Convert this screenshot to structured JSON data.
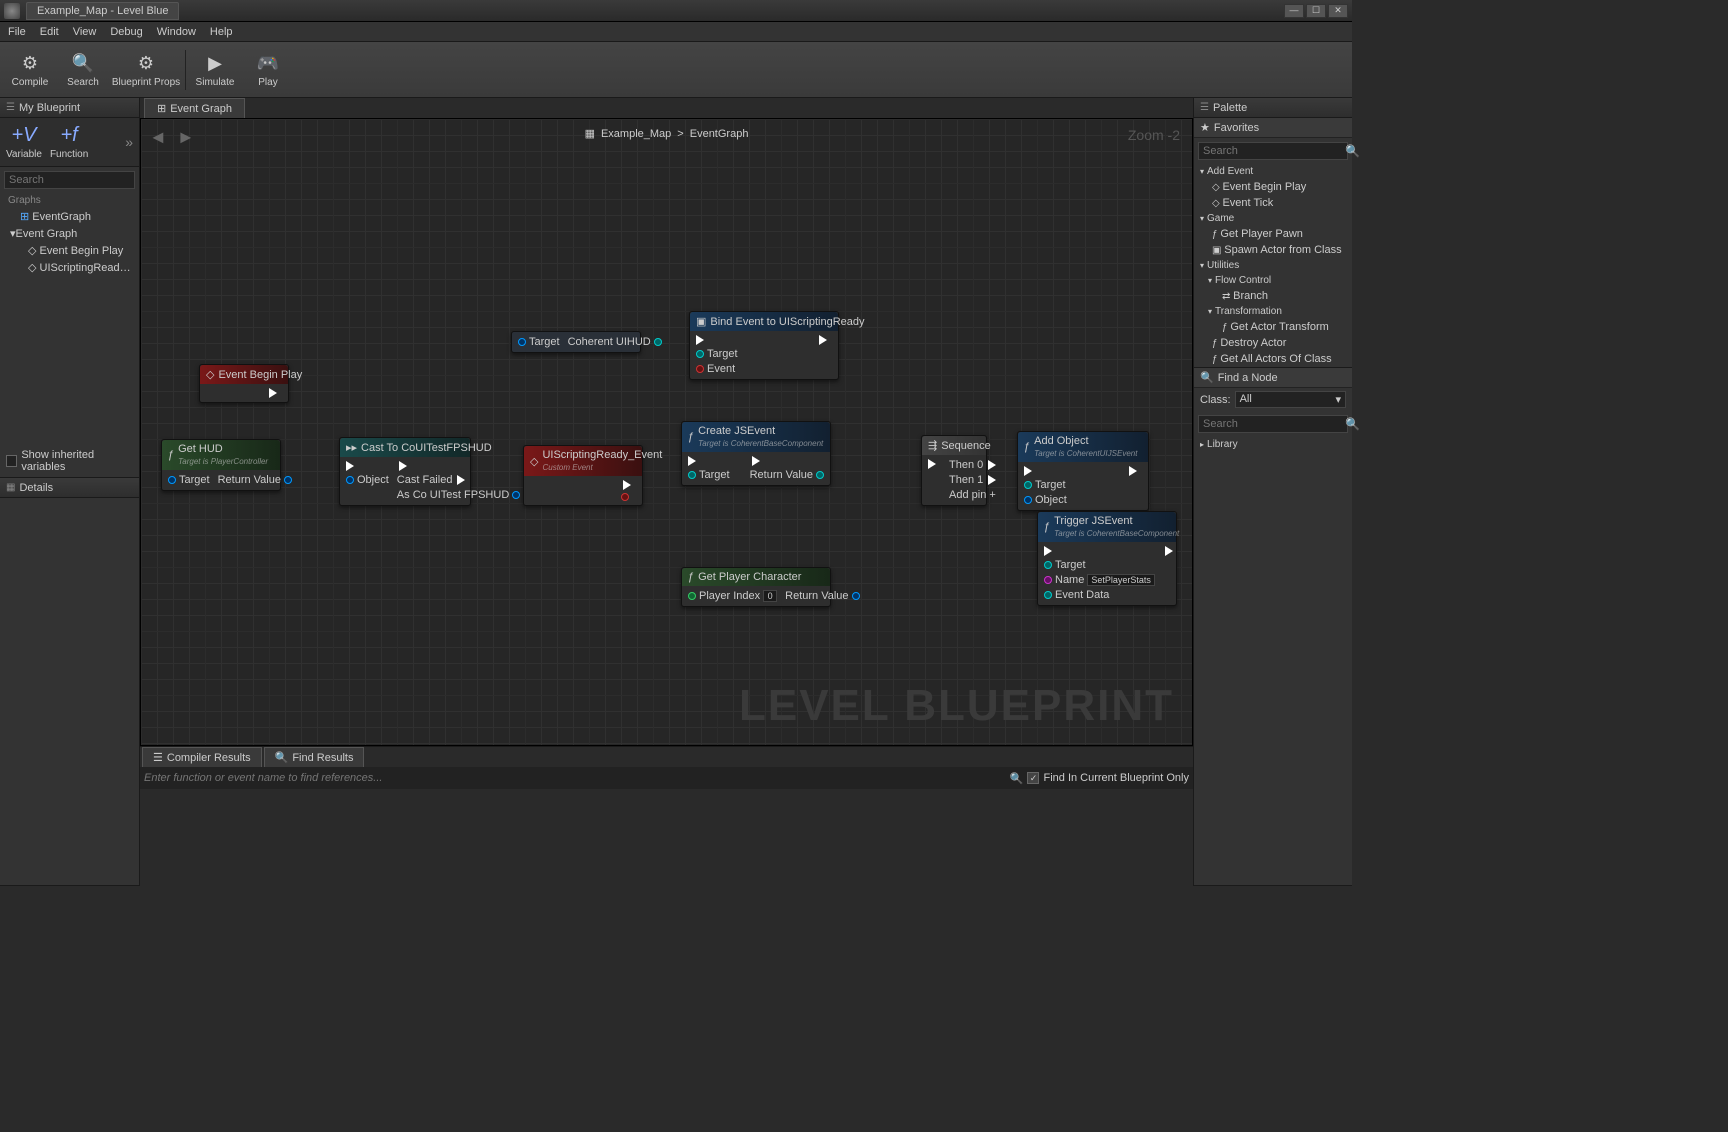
{
  "window": {
    "title": "Example_Map - Level Blue"
  },
  "winbuttons": {
    "min": "—",
    "max": "☐",
    "close": "✕"
  },
  "menu": [
    "File",
    "Edit",
    "View",
    "Debug",
    "Window",
    "Help"
  ],
  "toolbar": [
    {
      "label": "Compile",
      "icon": "⚙"
    },
    {
      "label": "Search",
      "icon": "🔍"
    },
    {
      "label": "Blueprint Props",
      "icon": "⚙"
    },
    {
      "label": "Simulate",
      "icon": "▶"
    },
    {
      "label": "Play",
      "icon": "🎮"
    }
  ],
  "panels": {
    "myBlueprint": "My Blueprint",
    "details": "Details",
    "eventGraph": "Event Graph",
    "compilerResults": "Compiler Results",
    "findResults": "Find Results",
    "palette": "Palette"
  },
  "addButtons": {
    "variable": "Variable",
    "function": "Function",
    "varIcon": "+V",
    "funcIcon": "+f"
  },
  "searchPlaceholder": "Search",
  "graphsHdr": "Graphs",
  "tree": {
    "eventGraph": "EventGraph",
    "eventGraphExp": "Event Graph",
    "ev1": "Event Begin Play",
    "ev2": "UIScriptingReady_"
  },
  "showInherited": "Show inherited variables",
  "breadcrumb": {
    "map": "Example_Map",
    "sep": ">",
    "graph": "EventGraph"
  },
  "zoom": "Zoom -2",
  "watermark": "LEVEL BLUEPRINT",
  "nodes": {
    "eventBeginPlay": {
      "title": "Event Begin Play"
    },
    "getHUD": {
      "title": "Get HUD",
      "sub": "Target is PlayerController",
      "pinTarget": "Target",
      "pinRV": "Return Value"
    },
    "castTo": {
      "title": "Cast To CoUITestFPSHUD",
      "pinObject": "Object",
      "pinCastFailed": "Cast Failed",
      "pinAsCo": "As Co UITest FPSHUD"
    },
    "uiHUD": {
      "pinTarget": "Target",
      "pinOut": "Coherent UIHUD"
    },
    "bindEvent": {
      "title": "Bind Event to UIScriptingReady",
      "pinTarget": "Target",
      "pinEvent": "Event"
    },
    "uiScripting": {
      "title": "UIScriptingReady_Event",
      "sub": "Custom Event"
    },
    "createJS": {
      "title": "Create JSEvent",
      "sub": "Target is CoherentBaseComponent",
      "pinTarget": "Target",
      "pinRV": "Return Value"
    },
    "getPlayer": {
      "title": "Get Player Character",
      "pinIdx": "Player Index",
      "pinIdxVal": "0",
      "pinRV": "Return Value"
    },
    "sequence": {
      "title": "Sequence",
      "pinThen0": "Then 0",
      "pinThen1": "Then 1",
      "pinAdd": "Add pin +"
    },
    "addObject": {
      "title": "Add Object",
      "sub": "Target is CoherentUIJSEvent",
      "pinTarget": "Target",
      "pinObject": "Object"
    },
    "trigger": {
      "title": "Trigger JSEvent",
      "sub": "Target is CoherentBaseComponent",
      "pinTarget": "Target",
      "pinName": "Name",
      "pinNameVal": "SetPlayerStats",
      "pinEventData": "Event Data"
    }
  },
  "findPlaceholder": "Enter function or event name to find references...",
  "findInCurrent": "Find In Current Blueprint Only",
  "palette": {
    "favorites": "Favorites",
    "addEvent": "Add Event",
    "eventBeginPlay": "Event Begin Play",
    "eventTick": "Event Tick",
    "game": "Game",
    "getPlayerPawn": "Get Player Pawn",
    "spawnActor": "Spawn Actor from Class",
    "utilities": "Utilities",
    "flowControl": "Flow Control",
    "branch": "Branch",
    "transformation": "Transformation",
    "getActorTransform": "Get Actor Transform",
    "destroyActor": "Destroy Actor",
    "getAllActors": "Get All Actors Of Class",
    "findNode": "Find a Node",
    "classLbl": "Class:",
    "classVal": "All",
    "library": "Library"
  }
}
